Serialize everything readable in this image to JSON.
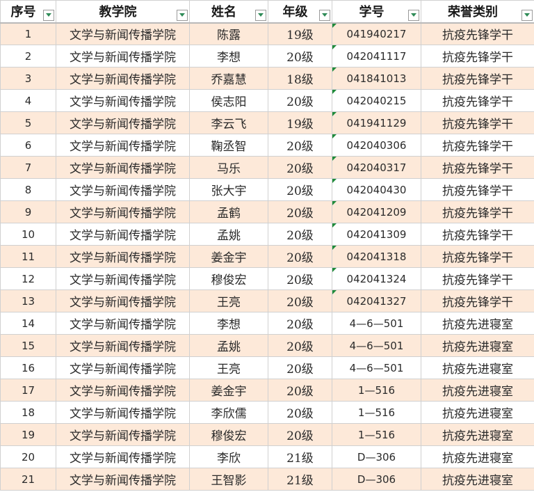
{
  "colors": {
    "header_bg": "#ffffff",
    "band_bg": "#fde9d9",
    "grid": "#d0d0d0",
    "filter_arrow": "#2e8b57",
    "text_marker": "#1f8b3a"
  },
  "headers": [
    "序号",
    "教学院",
    "姓名",
    "年级",
    "学号",
    "荣誉类别"
  ],
  "header_icon": "filter-dropdown-icon",
  "rows": [
    {
      "no": "1",
      "college": "文学与新闻传播学院",
      "name": "陈露",
      "grade": "19级",
      "id": "041940217",
      "honor": "抗疫先锋学干",
      "text_marker": true
    },
    {
      "no": "2",
      "college": "文学与新闻传播学院",
      "name": "李想",
      "grade": "20级",
      "id": "042041117",
      "honor": "抗疫先锋学干",
      "text_marker": true
    },
    {
      "no": "3",
      "college": "文学与新闻传播学院",
      "name": "乔嘉慧",
      "grade": "18级",
      "id": "041841013",
      "honor": "抗疫先锋学干",
      "text_marker": true
    },
    {
      "no": "4",
      "college": "文学与新闻传播学院",
      "name": "侯志阳",
      "grade": "20级",
      "id": "042040215",
      "honor": "抗疫先锋学干",
      "text_marker": true
    },
    {
      "no": "5",
      "college": "文学与新闻传播学院",
      "name": "李云飞",
      "grade": "19级",
      "id": "041941129",
      "honor": "抗疫先锋学干",
      "text_marker": true
    },
    {
      "no": "6",
      "college": "文学与新闻传播学院",
      "name": "鞠丞智",
      "grade": "20级",
      "id": "042040306",
      "honor": "抗疫先锋学干",
      "text_marker": true
    },
    {
      "no": "7",
      "college": "文学与新闻传播学院",
      "name": "马乐",
      "grade": "20级",
      "id": "042040317",
      "honor": "抗疫先锋学干",
      "text_marker": true
    },
    {
      "no": "8",
      "college": "文学与新闻传播学院",
      "name": "张大宇",
      "grade": "20级",
      "id": "042040430",
      "honor": "抗疫先锋学干",
      "text_marker": true
    },
    {
      "no": "9",
      "college": "文学与新闻传播学院",
      "name": "孟鹤",
      "grade": "20级",
      "id": "042041209",
      "honor": "抗疫先锋学干",
      "text_marker": true
    },
    {
      "no": "10",
      "college": "文学与新闻传播学院",
      "name": "孟姚",
      "grade": "20级",
      "id": "042041309",
      "honor": "抗疫先锋学干",
      "text_marker": true
    },
    {
      "no": "11",
      "college": "文学与新闻传播学院",
      "name": "姜金宇",
      "grade": "20级",
      "id": "042041318",
      "honor": "抗疫先锋学干",
      "text_marker": true
    },
    {
      "no": "12",
      "college": "文学与新闻传播学院",
      "name": "穆俊宏",
      "grade": "20级",
      "id": "042041324",
      "honor": "抗疫先锋学干",
      "text_marker": true
    },
    {
      "no": "13",
      "college": "文学与新闻传播学院",
      "name": "王亮",
      "grade": "20级",
      "id": "042041327",
      "honor": "抗疫先锋学干",
      "text_marker": true
    },
    {
      "no": "14",
      "college": "文学与新闻传播学院",
      "name": "李想",
      "grade": "20级",
      "id": "4—6—501",
      "honor": "抗疫先进寝室",
      "text_marker": false
    },
    {
      "no": "15",
      "college": "文学与新闻传播学院",
      "name": "孟姚",
      "grade": "20级",
      "id": "4—6—501",
      "honor": "抗疫先进寝室",
      "text_marker": false
    },
    {
      "no": "16",
      "college": "文学与新闻传播学院",
      "name": "王亮",
      "grade": "20级",
      "id": "4—6—501",
      "honor": "抗疫先进寝室",
      "text_marker": false
    },
    {
      "no": "17",
      "college": "文学与新闻传播学院",
      "name": "姜金宇",
      "grade": "20级",
      "id": "1—516",
      "honor": "抗疫先进寝室",
      "text_marker": false
    },
    {
      "no": "18",
      "college": "文学与新闻传播学院",
      "name": "李欣儒",
      "grade": "20级",
      "id": "1—516",
      "honor": "抗疫先进寝室",
      "text_marker": false
    },
    {
      "no": "19",
      "college": "文学与新闻传播学院",
      "name": "穆俊宏",
      "grade": "20级",
      "id": "1—516",
      "honor": "抗疫先进寝室",
      "text_marker": false
    },
    {
      "no": "20",
      "college": "文学与新闻传播学院",
      "name": "李欣",
      "grade": "21级",
      "id": "D—306",
      "honor": "抗疫先进寝室",
      "text_marker": false
    },
    {
      "no": "21",
      "college": "文学与新闻传播学院",
      "name": "王智影",
      "grade": "21级",
      "id": "D—306",
      "honor": "抗疫先进寝室",
      "text_marker": false
    }
  ]
}
